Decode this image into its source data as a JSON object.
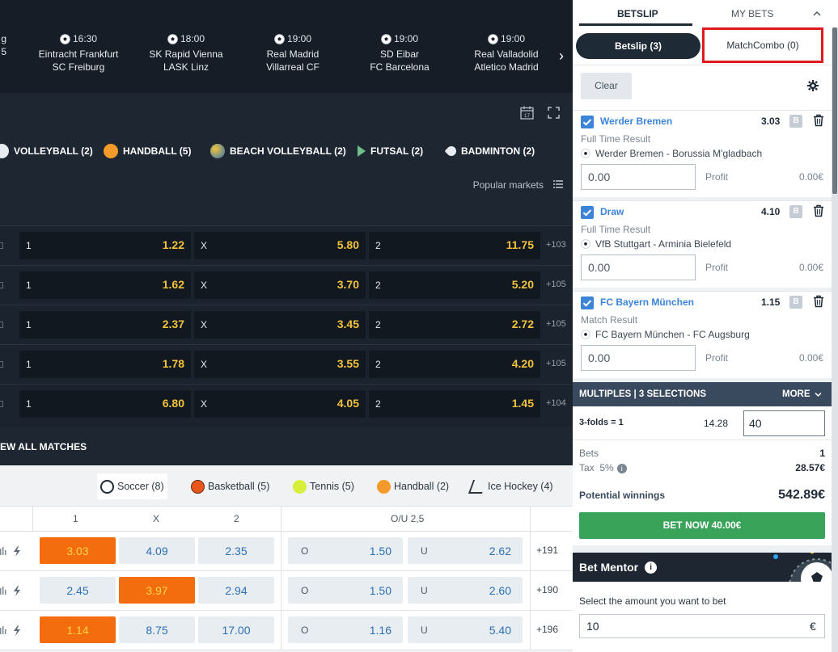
{
  "events": [
    {
      "time": "16:30",
      "home": "Eintracht Frankfurt",
      "away": "SC Freiburg"
    },
    {
      "time": "18:00",
      "home": "SK Rapid Vienna",
      "away": "LASK Linz"
    },
    {
      "time": "19:00",
      "home": "Real Madrid",
      "away": "Villarreal CF"
    },
    {
      "time": "19:00",
      "home": "SD Eibar",
      "away": "FC Barcelona"
    },
    {
      "time": "19:00",
      "home": "Real Valladolid",
      "away": "Atletico Madrid"
    }
  ],
  "events_partial": {
    "line1": "g",
    "line2": "5"
  },
  "calendar_day": "17",
  "sports": [
    {
      "label": "VOLLEYBALL (2)",
      "icon": "volleyball-icon"
    },
    {
      "label": "HANDBALL (5)",
      "icon": "handball-icon"
    },
    {
      "label": "BEACH VOLLEYBALL (2)",
      "icon": "beach-volleyball-icon"
    },
    {
      "label": "FUTSAL (2)",
      "icon": "futsal-icon"
    },
    {
      "label": "BADMINTON (2)",
      "icon": "badminton-icon"
    }
  ],
  "popular_markets_label": "Popular markets",
  "market_rows": [
    {
      "o1": "1.22",
      "ox": "5.80",
      "o2": "11.75",
      "more": "+103"
    },
    {
      "o1": "1.62",
      "ox": "3.70",
      "o2": "5.20",
      "more": "+105"
    },
    {
      "o1": "2.37",
      "ox": "3.45",
      "o2": "2.72",
      "more": "+105"
    },
    {
      "o1": "1.78",
      "ox": "3.55",
      "o2": "4.20",
      "more": "+105"
    },
    {
      "o1": "6.80",
      "ox": "4.05",
      "o2": "1.45",
      "more": "+104"
    }
  ],
  "outcome_keys": {
    "home": "1",
    "draw": "X",
    "away": "2"
  },
  "view_all_label": "EW ALL MATCHES",
  "sport_tabs": [
    {
      "label": "Soccer (8)",
      "icon": "soccer-icon"
    },
    {
      "label": "Basketball (5)",
      "icon": "basketball-icon"
    },
    {
      "label": "Tennis (5)",
      "icon": "tennis-icon"
    },
    {
      "label": "Handball (2)",
      "icon": "handball-icon"
    },
    {
      "label": "Ice Hockey (4)",
      "icon": "ice-hockey-icon"
    }
  ],
  "col_headers": {
    "c1": "1",
    "cx": "X",
    "c2": "2",
    "ou": "O/U 2,5"
  },
  "ou_keys": {
    "over": "O",
    "under": "U"
  },
  "live_rows": [
    {
      "o1": "3.03",
      "ox": "4.09",
      "o2": "2.35",
      "over": "1.50",
      "under": "2.62",
      "more": "+191",
      "hl": "o1"
    },
    {
      "o1": "2.45",
      "ox": "3.97",
      "o2": "2.94",
      "over": "1.50",
      "under": "2.60",
      "more": "+190",
      "hl": "ox"
    },
    {
      "o1": "1.14",
      "ox": "8.75",
      "o2": "17.00",
      "over": "1.16",
      "under": "5.40",
      "more": "+196",
      "hl": "o1"
    }
  ],
  "slip": {
    "tab_betslip": "BETSLIP",
    "tab_mybets": "MY BETS",
    "btn_betslip": "Betslip (3)",
    "btn_combo": "MatchCombo (0)",
    "clear": "Clear",
    "bets": [
      {
        "selection": "Werder Bremen",
        "odd": "3.03",
        "market": "Full Time Result",
        "match": "Werder Bremen - Borussia M'gladbach",
        "stake": "0.00",
        "profit_label": "Profit",
        "profit": "0.00€"
      },
      {
        "selection": "Draw",
        "odd": "4.10",
        "market": "Full Time Result",
        "match": "VfB Stuttgart - Arminia Bielefeld",
        "stake": "0.00",
        "profit_label": "Profit",
        "profit": "0.00€"
      },
      {
        "selection": "FC Bayern München",
        "odd": "1.15",
        "market": "Match Result",
        "match": "FC Bayern München - FC Augsburg",
        "stake": "0.00",
        "profit_label": "Profit",
        "profit": "0.00€"
      }
    ],
    "b_badge": "B",
    "multiples_label": "MULTIPLES | 3 SELECTIONS",
    "more_label": "MORE",
    "folds_label": "3-folds = 1",
    "folds_odd": "14.28",
    "folds_stake": "40",
    "bets_label": "Bets",
    "bets_count": "1",
    "tax_label": "Tax",
    "tax_rate": "5%",
    "tax_value": "28.57€",
    "potential_label": "Potential winnings",
    "potential_value": "542.89€",
    "bet_now": "BET NOW 40.00€",
    "mentor_title": "Bet Mentor",
    "mentor_prompt": "Select the amount you want to bet",
    "mentor_amount": "10",
    "currency": "€"
  },
  "colors": {
    "odds_yellow": "#f3c33b",
    "highlight_orange": "#f36d0e",
    "accent_blue": "#3b84d8",
    "bet_green": "#3aa35a",
    "combo_red_border": "#e0191e"
  }
}
